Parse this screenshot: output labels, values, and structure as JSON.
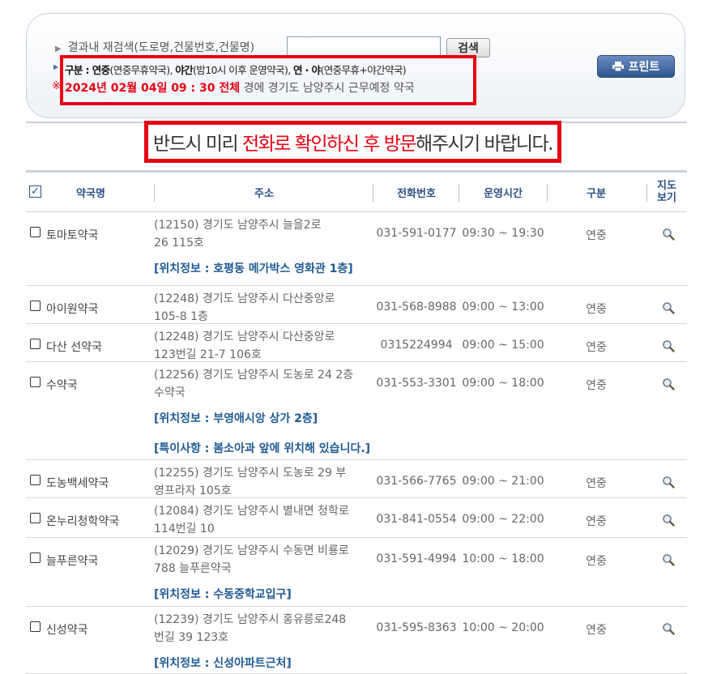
{
  "search": {
    "label": "결과내 재검색(도로명,건물번호,건물명)",
    "value": "",
    "button": "검색",
    "print_button": "프린트"
  },
  "legend": {
    "title": "구분 : ",
    "item1": "연중",
    "item1_desc": "(연중무휴약국), ",
    "item2": "야간",
    "item2_desc": "(밤10시 이후 운영약국), ",
    "item3": "연 · 야",
    "item3_desc": "(연중무휴+야간약국)"
  },
  "date_line": {
    "mark": "※",
    "highlight": "2024년 02월 04일 09 : 30 전체",
    "rest": " 경에  경기도  남양주시   근무예정 약국"
  },
  "notice": {
    "part1": "반드시 미리 ",
    "highlight": "전화로 확인하신 후 방문",
    "part2": "해주시기 바랍니다."
  },
  "table": {
    "headers": {
      "name": "약국명",
      "address": "주소",
      "phone": "전화번호",
      "hours": "운영시간",
      "type": "구분",
      "map_line1": "지도",
      "map_line2": "보기"
    },
    "rows": [
      {
        "name": "토마토약국",
        "addr1": "(12150) 경기도 남양주시 늘을2로",
        "addr2": "26 115호",
        "phone": "031-591-0177",
        "hours": "09:30 ~ 19:30",
        "type": "연중",
        "info1": "[위치정보 : 호평동 메가박스 영화관 1층]",
        "info2": ""
      },
      {
        "name": "아이원약국",
        "addr1": "(12248) 경기도 남양주시 다산중앙로",
        "addr2": "105-8 1층",
        "phone": "031-568-8988",
        "hours": "09:00 ~ 13:00",
        "type": "연중",
        "info1": "",
        "info2": ""
      },
      {
        "name": "다산 선약국",
        "addr1": "(12248) 경기도 남양주시 다산중앙로",
        "addr2": "123번길 21-7 106호",
        "phone": "0315224994",
        "hours": "09:00 ~ 15:00",
        "type": "연중",
        "info1": "",
        "info2": ""
      },
      {
        "name": "수약국",
        "addr1": "(12256) 경기도 남양주시 도농로 24 2층",
        "addr2": "수약국",
        "phone": "031-553-3301",
        "hours": "09:00 ~ 18:00",
        "type": "연중",
        "info1": "[위치정보 : 부영애시앙 상가 2층]",
        "info2": "[특이사항 : 봄소아과 앞에 위치해 있습니다.]"
      },
      {
        "name": "도농백세약국",
        "addr1": "(12255) 경기도 남양주시 도농로 29 부",
        "addr2": "영프라자 105호",
        "phone": "031-566-7765",
        "hours": "09:00 ~ 21:00",
        "type": "연중",
        "info1": "",
        "info2": ""
      },
      {
        "name": "온누리청학약국",
        "addr1": "(12084) 경기도 남양주시 별내면 청학로",
        "addr2": "114번길 10",
        "phone": "031-841-0554",
        "hours": "09:00 ~ 22:00",
        "type": "연중",
        "info1": "",
        "info2": ""
      },
      {
        "name": "늘푸른약국",
        "addr1": "(12029) 경기도 남양주시 수동면 비룡로",
        "addr2": "788 늘푸른약국",
        "phone": "031-591-4994",
        "hours": "10:00 ~ 18:00",
        "type": "연중",
        "info1": "[위치정보 : 수동중학교입구]",
        "info2": ""
      },
      {
        "name": "신성약국",
        "addr1": "(12239) 경기도 남양주시 홍유릉로248",
        "addr2": "번길 39 123호",
        "phone": "031-595-8363",
        "hours": "10:00 ~ 20:00",
        "type": "연중",
        "info1": "[위치정보 : 신성아파트근처]",
        "info2": ""
      }
    ]
  }
}
